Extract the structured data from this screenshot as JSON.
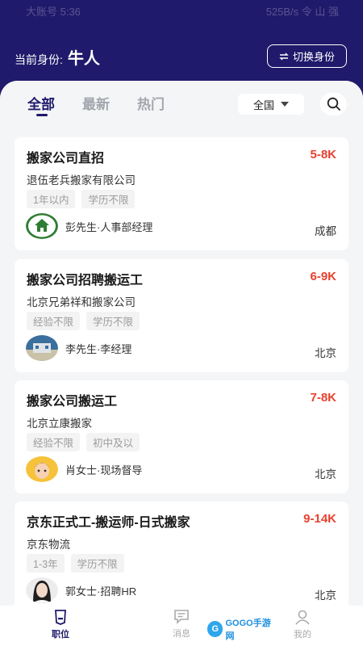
{
  "status_bar": {
    "left": "大账号 5:36",
    "right": "525B/s 令 山 强"
  },
  "header": {
    "identity_label": "当前身份:",
    "identity_value": "牛人",
    "switch_button": "切换身份",
    "switch_icon": "swap-icon"
  },
  "tabs": [
    {
      "label": "全部"
    },
    {
      "label": "最新"
    },
    {
      "label": "热门"
    }
  ],
  "region": {
    "label": "全国"
  },
  "jobs": [
    {
      "title": "搬家公司直招",
      "salary": "5-8K",
      "company": "退伍老兵搬家有限公司",
      "tags": [
        "1年以内",
        "学历不限"
      ],
      "recruiter": "彭先生·人事部经理",
      "city": "成都"
    },
    {
      "title": "搬家公司招聘搬运工",
      "salary": "6-9K",
      "company": "北京兄弟祥和搬家公司",
      "tags": [
        "经验不限",
        "学历不限"
      ],
      "recruiter": "李先生·李经理",
      "city": "北京"
    },
    {
      "title": "搬家公司搬运工",
      "salary": "7-8K",
      "company": "北京立康搬家",
      "tags": [
        "经验不限",
        "初中及以"
      ],
      "recruiter": "肖女士·现场督导",
      "city": "北京"
    },
    {
      "title": "京东正式工-搬运师-日式搬家",
      "salary": "9-14K",
      "company": "京东物流",
      "tags": [
        "1-3年",
        "学历不限"
      ],
      "recruiter": "郭女士·招聘HR",
      "city": "北京"
    }
  ],
  "bottom_nav": [
    {
      "label": "职位",
      "icon": "badge-icon"
    },
    {
      "label": "消息",
      "icon": "chat-icon"
    },
    {
      "label": "我的",
      "icon": "user-icon"
    }
  ],
  "watermark": {
    "text": "GOGO手游网"
  },
  "colors": {
    "brand": "#1f1a6b",
    "salary": "#e8412f",
    "background": "#f4f5f7"
  }
}
